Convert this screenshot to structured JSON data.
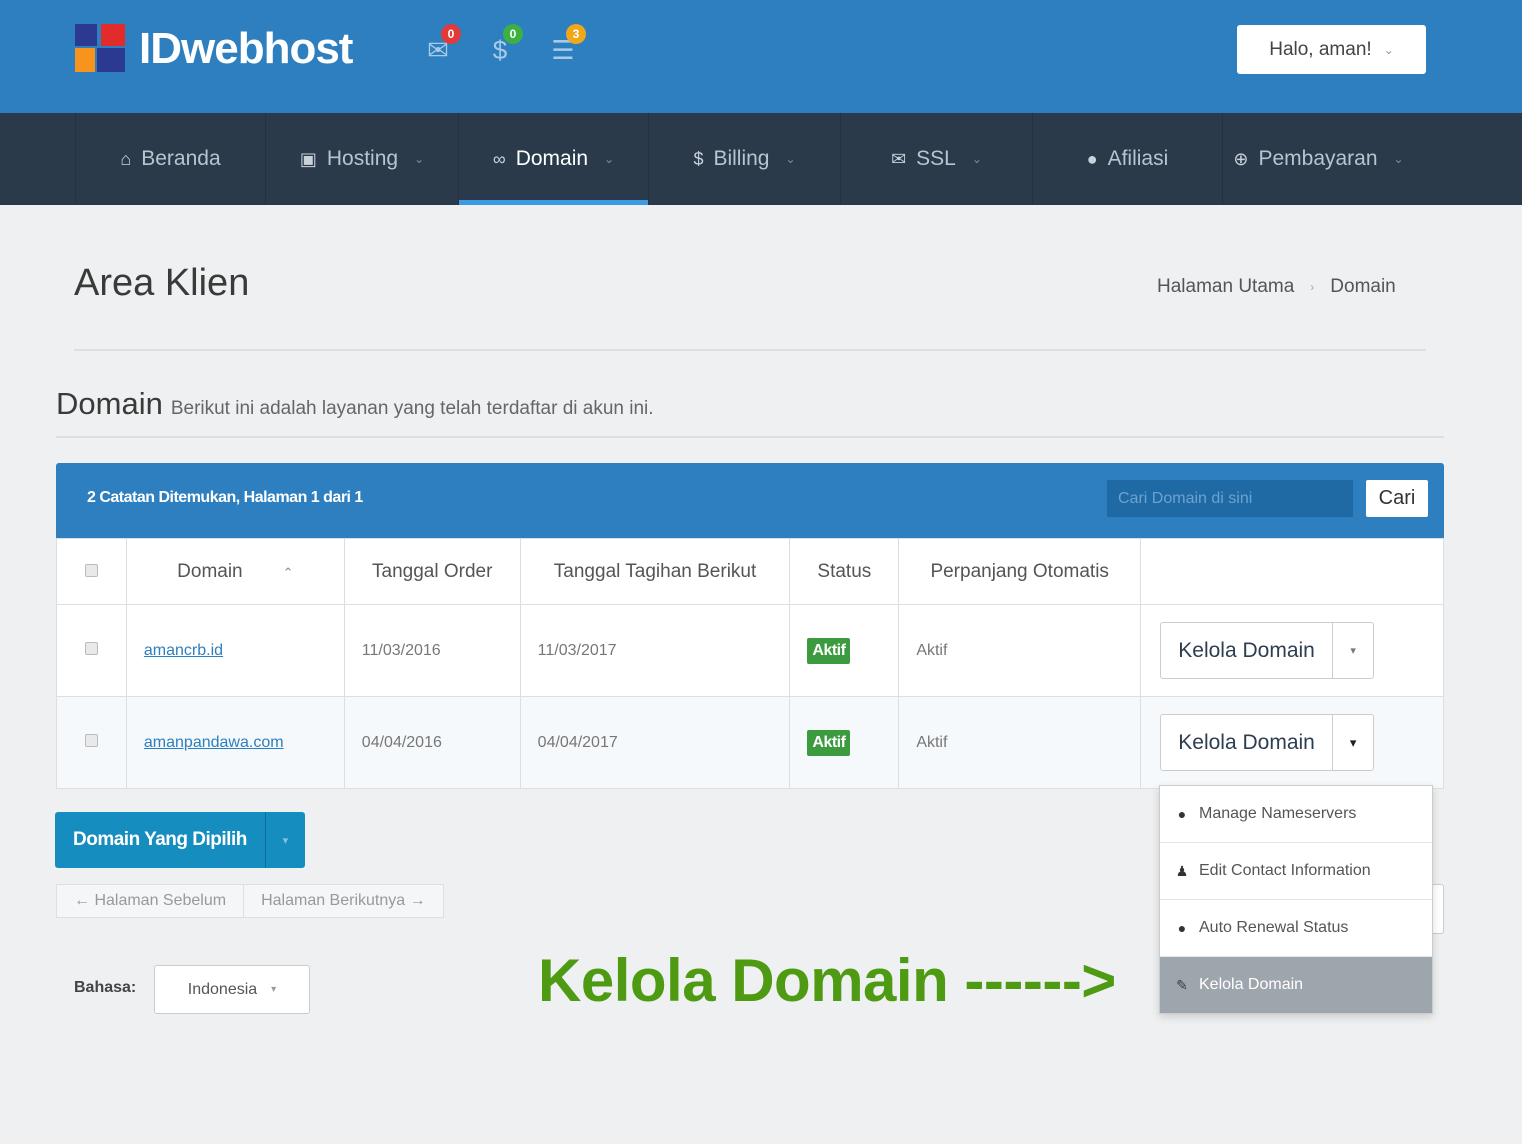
{
  "header": {
    "logo_text": "IDwebhost",
    "icons": [
      {
        "name": "mail-icon",
        "badge": "0",
        "badge_color": "#e03a3a"
      },
      {
        "name": "dollar-icon",
        "badge": "0",
        "badge_color": "#3cb043"
      },
      {
        "name": "chat-icon",
        "badge": "3",
        "badge_color": "#f0a818"
      }
    ],
    "user_greeting": "Halo, aman!"
  },
  "nav": {
    "items": [
      {
        "label": "Beranda",
        "icon": "home-icon"
      },
      {
        "label": "Hosting",
        "icon": "server-icon"
      },
      {
        "label": "Domain",
        "icon": "binoculars-icon"
      },
      {
        "label": "Billing",
        "icon": "dollar-icon"
      },
      {
        "label": "SSL",
        "icon": "certificate-icon"
      },
      {
        "label": "Afiliasi",
        "icon": "user-icon"
      },
      {
        "label": "Pembayaran",
        "icon": "globe-icon"
      }
    ]
  },
  "page": {
    "title": "Area Klien",
    "breadcrumb": [
      "Halaman Utama",
      "Domain"
    ]
  },
  "section": {
    "title": "Domain",
    "subtitle": "Berikut ini adalah layanan yang telah terdaftar di akun ini."
  },
  "table": {
    "records_text": "2 Catatan Ditemukan, Halaman 1 dari 1",
    "search_placeholder": "Cari Domain di sini",
    "search_button": "Cari",
    "columns": [
      "Domain",
      "Tanggal Order",
      "Tanggal Tagihan Berikut",
      "Status",
      "Perpanjang Otomatis"
    ],
    "rows": [
      {
        "domain": "amancrb.id",
        "order_date": "11/03/2016",
        "next_due": "11/03/2017",
        "status": "Aktif",
        "auto_renew": "Aktif",
        "action": "Kelola Domain"
      },
      {
        "domain": "amanpandawa.com",
        "order_date": "04/04/2016",
        "next_due": "04/04/2017",
        "status": "Aktif",
        "auto_renew": "Aktif",
        "action": "Kelola Domain"
      }
    ]
  },
  "dropdown": {
    "items": [
      {
        "label": "Manage Nameservers",
        "icon": "globe-icon"
      },
      {
        "label": "Edit Contact Information",
        "icon": "user-icon"
      },
      {
        "label": "Auto Renewal Status",
        "icon": "globe-icon"
      },
      {
        "label": "Kelola Domain",
        "icon": "pencil-icon"
      }
    ]
  },
  "bulk": {
    "label": "Domain Yang Dipilih"
  },
  "pagination": {
    "prev": "← Halaman Sebelum",
    "next": "Halaman Berikutnya →"
  },
  "language": {
    "label": "Bahasa:",
    "value": "Indonesia"
  },
  "annotation": {
    "text": "Kelola Domain ------>",
    "color": "#4e9a12"
  }
}
